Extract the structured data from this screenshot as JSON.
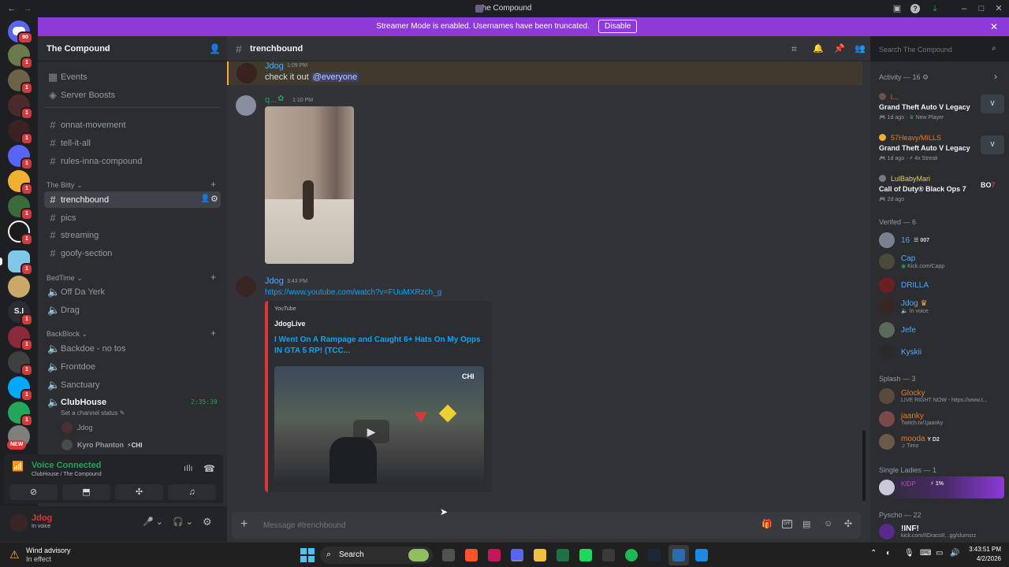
{
  "window": {
    "title": "The Compound"
  },
  "banner": {
    "text": "Streamer Mode is enabled. Usernames have been truncated.",
    "button": "Disable"
  },
  "rail": {
    "dm_badge": "90",
    "new_label": "NEW",
    "badges": [
      "1",
      "1",
      "1",
      "1",
      "1",
      "1",
      "1",
      "1",
      "1",
      "1",
      "1",
      "1",
      "1",
      "1"
    ],
    "text_server": "S.I"
  },
  "server": {
    "name": "The Compound",
    "top_items": [
      {
        "label": "Events",
        "icon": "calendar-icon"
      },
      {
        "label": "Server Boosts",
        "icon": "boost-icon"
      }
    ],
    "channels_a": [
      "onnat-movement",
      "tell-it-all",
      "rules-inna-compound"
    ],
    "cat_bitty": "The Bitty",
    "channels_bitty": [
      "trenchbound",
      "pics",
      "streaming",
      "goofy-section"
    ],
    "cat_bedtime": "BedTime",
    "bedtime": [
      "Off Da Yerk",
      "Drag"
    ],
    "cat_backblock": "BackBlock",
    "backblock": [
      "Backdoe - no tos",
      "Frontdoe",
      "Sanctuary"
    ],
    "clubhouse": {
      "name": "ClubHouse",
      "timer": "2:35:39",
      "status": "Set a channel status",
      "users": [
        "Jdog",
        "Kyro Phanton"
      ],
      "tag": "CHI"
    }
  },
  "voice": {
    "status": "Voice Connected",
    "location": "ClubHouse / The Compound"
  },
  "user": {
    "name": "Jdog",
    "status": "In voice"
  },
  "chat": {
    "channel": "trenchbound",
    "messages": [
      {
        "author": "Jdog",
        "time": "1:09 PM",
        "text": "check it out",
        "mention": "@everyone"
      },
      {
        "author": "q...",
        "time": "1:10 PM"
      },
      {
        "author": "Jdog",
        "time": "3:43 PM",
        "link": "https://www.youtube.com/watch?v=FUuMXRzch_g"
      }
    ],
    "embed": {
      "provider": "YouTube",
      "author": "JdogLive",
      "title": "I Went On A Rampage and Caught 6+ Hats On My Opps IN GTA 5 RP! (TCC...",
      "thumb_tag": "CHI"
    },
    "input_placeholder": "Message #trenchbound"
  },
  "search": {
    "placeholder": "Search The Compound"
  },
  "members": {
    "activity_header": "Activity — 16",
    "activities": [
      {
        "user": "i...",
        "game": "Grand Theft Auto V Legacy",
        "time": "1d ago",
        "detail": "New Player"
      },
      {
        "user": "57Heavy/MILLS",
        "game": "Grand Theft Auto V Legacy",
        "time": "1d ago",
        "detail": "4x Streak"
      },
      {
        "user": "LulBabyMari",
        "game": "Call of Duty® Black Ops 7",
        "time": "2d ago",
        "detail": ""
      }
    ],
    "verified_header": "Verifed — 6",
    "verified": [
      {
        "name": "16",
        "sub": "",
        "tag": "007",
        "color": "#56a8f8"
      },
      {
        "name": "Cap",
        "sub": "Kick.com/Capp",
        "tag": "",
        "color": "#56a8f8"
      },
      {
        "name": "DRILLA",
        "sub": "",
        "tag": "",
        "color": "#56a8f8"
      },
      {
        "name": "Jdog",
        "sub": "In voice",
        "tag": "",
        "color": "#56a8f8"
      },
      {
        "name": "Jefe",
        "sub": "",
        "tag": "",
        "color": "#56a8f8"
      },
      {
        "name": "Kyskii",
        "sub": "",
        "tag": "",
        "color": "#56a8f8"
      }
    ],
    "splash_header": "Splash — 3",
    "splash": [
      {
        "name": "Glocky",
        "sub": "LIVE RIGHT NOW - https://www.t...",
        "tag": "",
        "color": "#e67e22"
      },
      {
        "name": "jaanky",
        "sub": "Twitch.tv/1jaanky",
        "tag": "",
        "color": "#e67e22"
      },
      {
        "name": "mooda",
        "sub": "Timo",
        "tag": "D2",
        "color": "#e67e22"
      }
    ],
    "single_header": "Single Ladies — 1",
    "single": [
      {
        "name": "KIDP",
        "tag": "1%"
      }
    ],
    "pyscho_header": "Pyscho — 22",
    "pyscho": [
      {
        "name": "!INF!",
        "sub": "kick.com/IIDracoII, .gg/slumsrz"
      }
    ]
  },
  "taskbar": {
    "weather": "Wind advisory",
    "weather_sub": "In effect",
    "search": "Search",
    "time": "3:43:51 PM",
    "date": "4/2/2026"
  }
}
